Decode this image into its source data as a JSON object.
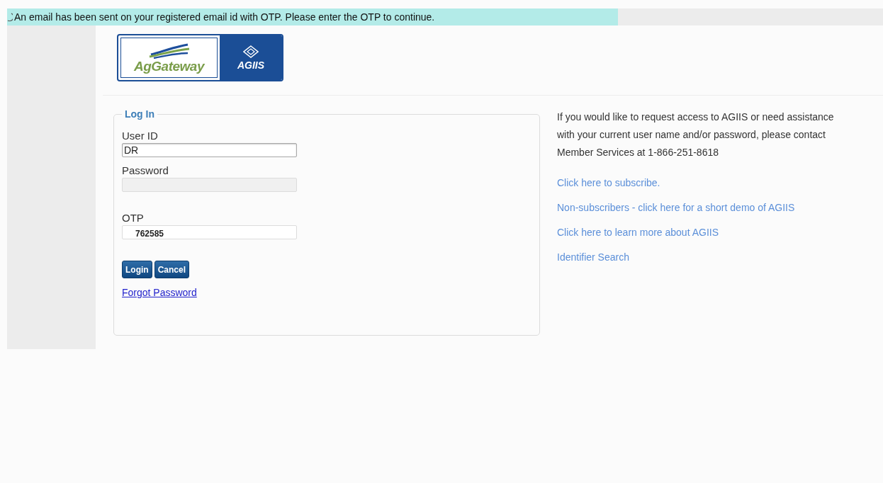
{
  "notice": {
    "text": "An email has been sent on your registered email id with OTP. Please enter the OTP to continue."
  },
  "logo": {
    "left_text": "AgGateway",
    "right_text": "AGIIS"
  },
  "login": {
    "legend": "Log In",
    "fields": [
      {
        "label": "User ID",
        "value": "DR",
        "disabled": false,
        "kind": "text"
      },
      {
        "label": "Password",
        "disabled": true,
        "kind": "password"
      },
      {
        "label": "OTP",
        "value": "762585",
        "disabled": false,
        "kind": "otp"
      }
    ],
    "buttons": [
      "Login",
      "Cancel"
    ],
    "forgot_link": "Forgot Password"
  },
  "info": {
    "text": "If you would like to request access to AGIIS or need assistance with your current user name and/or password, please contact Member Services at 1-866-251-8618",
    "links": [
      "Click here to subscribe.",
      "Non-subscribers - click here for a short demo of AGIIS",
      "Click here to learn more about AGIIS",
      "Identifier Search"
    ]
  }
}
